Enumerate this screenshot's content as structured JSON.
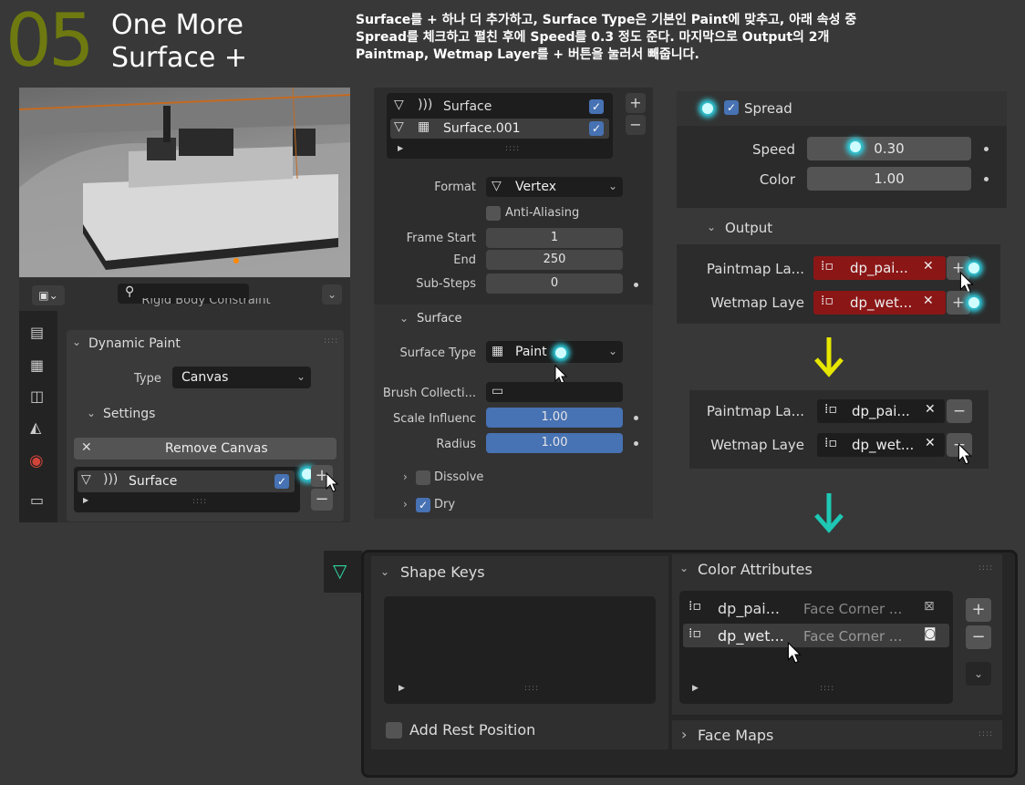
{
  "heading": {
    "step": "05",
    "title_line1": "One More",
    "title_line2": "Surface +"
  },
  "instruction": {
    "line1": "Surface를  + 하나 더 추가하고, Surface Type은 기본인 Paint에 맞추고, 아래 속성 중",
    "line2": "Spread를 체크하고 펼친 후에 Speed를 0.3 정도 준다.  마지막으로 Output의 2개",
    "line3": "Paintmap, Wetmap  Layer를 + 버튼을 눌러서 빼줍니다."
  },
  "left_panel": {
    "partial_header": "Rigid Body Constraint",
    "section": "Dynamic Paint",
    "type_label": "Type",
    "type_value": "Canvas",
    "settings": "Settings",
    "remove_button": "Remove Canvas",
    "list_item": "Surface",
    "plus": "+",
    "minus": "−"
  },
  "middle_panel": {
    "surfaces": [
      "Surface",
      "Surface.001"
    ],
    "format_label": "Format",
    "format_value": "Vertex",
    "anti_aliasing": "Anti-Aliasing",
    "frame_start_label": "Frame Start",
    "frame_start": "1",
    "end_label": "End",
    "end": "250",
    "substeps_label": "Sub-Steps",
    "substeps": "0",
    "surface_section": "Surface",
    "surface_type_label": "Surface Type",
    "surface_type_value": "Paint",
    "brush_label": "Brush Collecti...",
    "scale_label": "Scale Influenc",
    "scale_value": "1.00",
    "radius_label": "Radius",
    "radius_value": "1.00",
    "dissolve": "Dissolve",
    "dry": "Dry",
    "plus": "+",
    "minus": "−"
  },
  "spread_panel": {
    "spread": "Spread",
    "speed_label": "Speed",
    "speed_value": "0.30",
    "color_label": "Color",
    "color_value": "1.00",
    "output": "Output"
  },
  "output_before": {
    "paintmap_label": "Paintmap La...",
    "paintmap_value": "dp_pai...",
    "wetmap_label": "Wetmap Laye",
    "wetmap_value": "dp_wet...",
    "plus": "+"
  },
  "output_after": {
    "paintmap_label": "Paintmap La...",
    "paintmap_value": "dp_pai...",
    "wetmap_label": "Wetmap Laye",
    "wetmap_value": "dp_wet...",
    "minus": "−"
  },
  "arrows": {
    "yellow": "#e6e600",
    "teal": "#1ec8b4"
  },
  "bottom_panel": {
    "shape_keys": "Shape Keys",
    "add_rest": "Add Rest Position",
    "color_attributes": "Color Attributes",
    "attr1_name": "dp_pai...",
    "attr1_domain": "Face Corner ...",
    "attr2_name": "dp_wet...",
    "attr2_domain": "Face Corner ...",
    "face_maps": "Face Maps",
    "plus": "+",
    "minus": "−"
  },
  "colors": {
    "accent": "#4772b3",
    "step_number": "#6e7a10",
    "highlight": "#2fd6e6",
    "red_field": "#8b1616"
  }
}
